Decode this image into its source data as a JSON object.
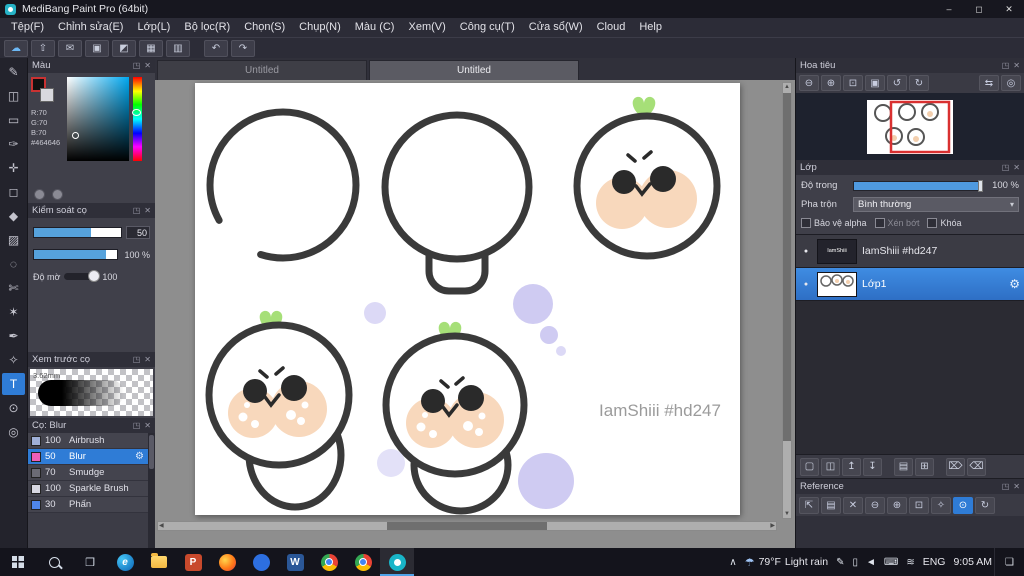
{
  "titlebar": {
    "title": "MediBang Paint Pro (64bit)",
    "minimize_glyph": "–",
    "maximize_glyph": "◻",
    "close_glyph": "✕"
  },
  "menu": {
    "items": [
      "Tệp(F)",
      "Chỉnh sửa(E)",
      "Lớp(L)",
      "Bộ lọc(R)",
      "Chọn(S)",
      "Chụp(N)",
      "Màu (C)",
      "Xem(V)",
      "Công cụ(T)",
      "Cửa sổ(W)",
      "Cloud",
      "Help"
    ]
  },
  "toolbar": {
    "icons": [
      {
        "name": "cloud",
        "glyph": "☁"
      },
      {
        "name": "publish",
        "glyph": "⇧"
      },
      {
        "name": "comment",
        "glyph": "✉"
      },
      {
        "name": "snapshot",
        "glyph": "▣"
      },
      {
        "name": "palette",
        "glyph": "◩"
      },
      {
        "name": "grid",
        "glyph": "▦"
      },
      {
        "name": "material",
        "glyph": "▥"
      }
    ],
    "undo_glyph": "↶",
    "redo_glyph": "↷"
  },
  "tools": [
    {
      "name": "pen",
      "glyph": "✎"
    },
    {
      "name": "eraser",
      "glyph": "◫"
    },
    {
      "name": "figure",
      "glyph": "▭"
    },
    {
      "name": "brush",
      "glyph": "✑"
    },
    {
      "name": "move",
      "glyph": "✛"
    },
    {
      "name": "select-rect",
      "glyph": "◻"
    },
    {
      "name": "bucket",
      "glyph": "◆"
    },
    {
      "name": "gradient",
      "glyph": "▨"
    },
    {
      "name": "select-ellipse",
      "glyph": "◌"
    },
    {
      "name": "lasso",
      "glyph": "✄"
    },
    {
      "name": "magic-wand",
      "glyph": "✶"
    },
    {
      "name": "control-pen",
      "glyph": "✒"
    },
    {
      "name": "eyedropper",
      "glyph": "✧"
    },
    {
      "name": "text",
      "glyph": "T"
    },
    {
      "name": "hand",
      "glyph": "⊙"
    },
    {
      "name": "zoom",
      "glyph": "◎"
    }
  ],
  "panel": {
    "popout_glyph": "◳",
    "close_glyph": "✕"
  },
  "color_panel": {
    "title": "Màu",
    "r": "R:70",
    "g": "G:70",
    "b": "B:70",
    "hex": "#464646"
  },
  "brush_control": {
    "title": "Kiểm soát cọ",
    "size_value": "50",
    "opacity_value": "100 %",
    "softness_label": "Độ mờ",
    "softness_value": "100"
  },
  "brush_preview": {
    "title": "Xem trước cọ",
    "size": "3.62mm"
  },
  "brush_list": {
    "title": "Cọ: Blur",
    "gear_glyph": "⚙",
    "items": [
      {
        "size": "100",
        "name": "Airbrush",
        "swatch": "#9fb0d8"
      },
      {
        "size": "50",
        "name": "Blur",
        "swatch": "#ef5fb7"
      },
      {
        "size": "70",
        "name": "Smudge",
        "swatch": "#6b6b75"
      },
      {
        "size": "100",
        "name": "Sparkle Brush",
        "swatch": "#d8d8e2"
      },
      {
        "size": "30",
        "name": "Phấn",
        "swatch": "#4f86e8"
      }
    ]
  },
  "doc_tabs": {
    "items": [
      {
        "label": "Untitled"
      },
      {
        "label": "Untitled"
      }
    ]
  },
  "canvas": {
    "signature": "IamShiii #hd247"
  },
  "navigator": {
    "title": "Hoa tiêu",
    "buttons": [
      {
        "name": "zoom-out",
        "glyph": "⊖"
      },
      {
        "name": "zoom-in",
        "glyph": "⊕"
      },
      {
        "name": "fit-window",
        "glyph": "⊡"
      },
      {
        "name": "actual-size",
        "glyph": "▣"
      },
      {
        "name": "rotate-left",
        "glyph": "↺"
      },
      {
        "name": "rotate-right",
        "glyph": "↻"
      }
    ],
    "right_buttons": [
      {
        "name": "flip-horizontal",
        "glyph": "⇆"
      },
      {
        "name": "reset-view",
        "glyph": "◎"
      }
    ]
  },
  "layer_panel": {
    "title": "Lớp",
    "opacity_label": "Độ trong",
    "opacity_value": "100 %",
    "blend_label": "Pha trộn",
    "blend_value": "Bình thường",
    "caret_glyph": "▾",
    "alpha_lock_label": "Bảo vệ alpha",
    "clip_label": "Xén bớt",
    "lock_label": "Khóa",
    "eye_glyph": "●",
    "gear_glyph": "⚙",
    "layers": [
      {
        "name": "IamShiii #hd247",
        "thumb_text": "IamShiii"
      },
      {
        "name": "Lớp1"
      }
    ],
    "buttons": [
      {
        "name": "new-layer",
        "glyph": "▢"
      },
      {
        "name": "duplicate-layer",
        "glyph": "◫"
      },
      {
        "name": "move-up",
        "glyph": "↥"
      },
      {
        "name": "move-down",
        "glyph": "↧"
      },
      {
        "name": "new-folder",
        "glyph": "▤"
      },
      {
        "name": "merge",
        "glyph": "⊞"
      },
      {
        "name": "clear",
        "glyph": "⌦"
      },
      {
        "name": "delete",
        "glyph": "⌫"
      }
    ]
  },
  "reference": {
    "title": "Reference",
    "buttons": [
      {
        "name": "pin",
        "glyph": "⇱"
      },
      {
        "name": "open",
        "glyph": "▤"
      },
      {
        "name": "close",
        "glyph": "✕"
      },
      {
        "name": "zoom-out",
        "glyph": "⊖"
      },
      {
        "name": "zoom-in",
        "glyph": "⊕"
      },
      {
        "name": "actual-size",
        "glyph": "⊡"
      },
      {
        "name": "eyedropper",
        "glyph": "✧"
      },
      {
        "name": "hand",
        "glyph": "⊙"
      },
      {
        "name": "rotate",
        "glyph": "↻"
      }
    ]
  },
  "taskbar": {
    "apps": [
      {
        "name": "edge",
        "glyph": "e"
      },
      {
        "name": "file-explorer",
        "glyph": ""
      },
      {
        "name": "powerpoint",
        "glyph": "P"
      },
      {
        "name": "firefox",
        "glyph": ""
      },
      {
        "name": "app-blue",
        "glyph": ""
      },
      {
        "name": "word",
        "glyph": "W"
      },
      {
        "name": "chrome",
        "glyph": ""
      },
      {
        "name": "chrome-2",
        "glyph": ""
      },
      {
        "name": "medibang",
        "glyph": ""
      }
    ],
    "tray": {
      "expand_glyph": "∧",
      "weather_icon_glyph": "☂",
      "weather_temp": "79°F",
      "weather_desc": "Light rain",
      "icons": [
        {
          "name": "pen-tray",
          "glyph": "✎"
        },
        {
          "name": "battery",
          "glyph": "▯"
        },
        {
          "name": "volume",
          "glyph": "◄"
        },
        {
          "name": "keyboard",
          "glyph": "⌨"
        },
        {
          "name": "network",
          "glyph": "≋"
        }
      ],
      "lang": "ENG",
      "time": "9:05 AM",
      "notification_glyph": "❏"
    }
  }
}
